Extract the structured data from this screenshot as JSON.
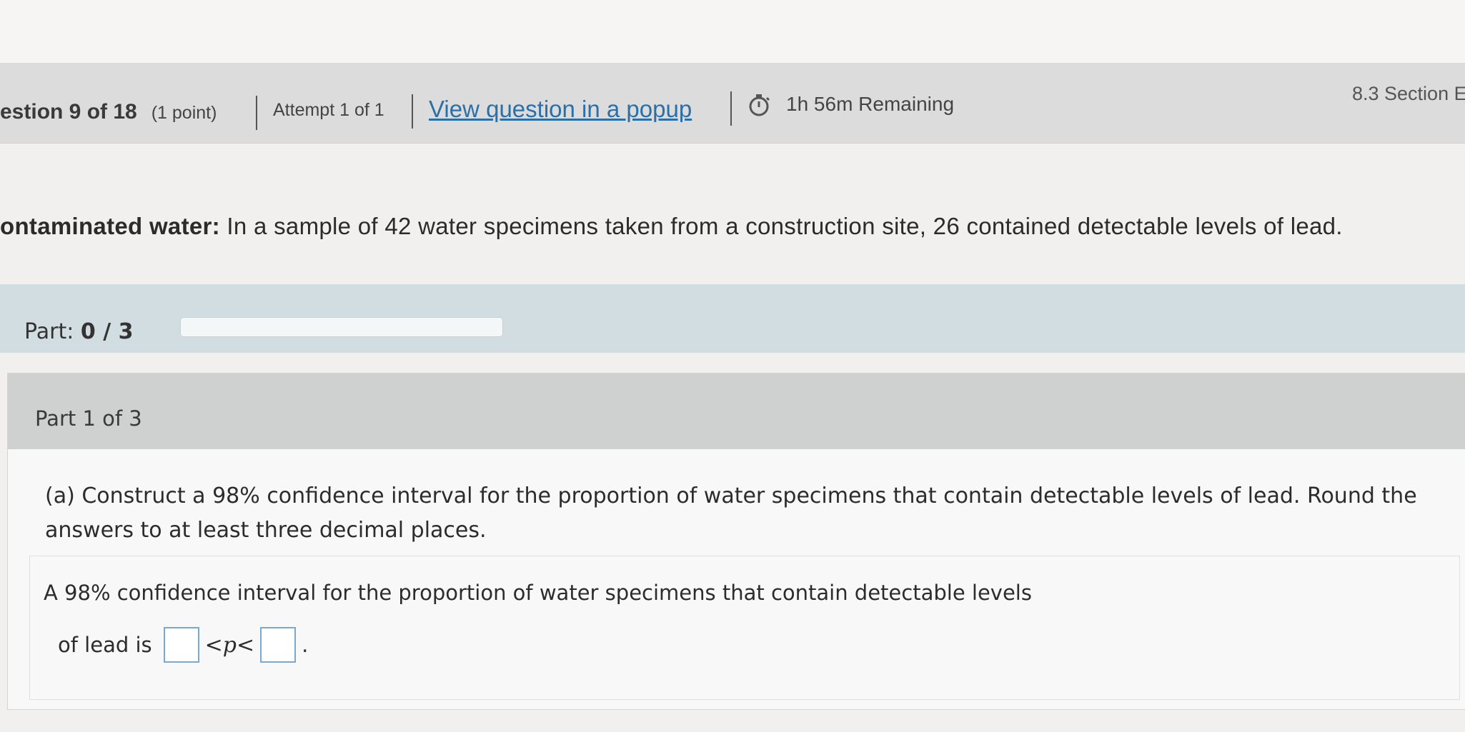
{
  "header": {
    "question_label": "estion 9 of 18",
    "points": "(1 point)",
    "attempt": "Attempt 1 of 1",
    "popup_link": "View question in a popup",
    "timer_icon": "stopwatch-icon",
    "timer": "1h 56m Remaining",
    "section": "8.3 Section E"
  },
  "problem": {
    "title": "ontaminated water:",
    "text": "In a sample of 42 water specimens taken from a construction site, 26 contained detectable levels of lead."
  },
  "progress": {
    "label": "Part:",
    "value": "0 / 3",
    "fraction_complete": 0
  },
  "part": {
    "header": "Part 1 of 3",
    "question": "(a) Construct a 98% confidence interval for the proportion of water specimens that contain detectable levels of lead. Round the answers to at least three decimal places.",
    "answer_line1": "A 98% confidence interval for the proportion of water specimens that contain detectable levels",
    "answer_line2_prefix": "of lead is",
    "inequality_left": "<",
    "variable": "p",
    "inequality_right": "<",
    "suffix": ".",
    "lower_value": "",
    "upper_value": ""
  },
  "colors": {
    "link": "#2a6fa8",
    "progress_fill": "#3d7fb0",
    "input_border": "#7aa9cf"
  }
}
